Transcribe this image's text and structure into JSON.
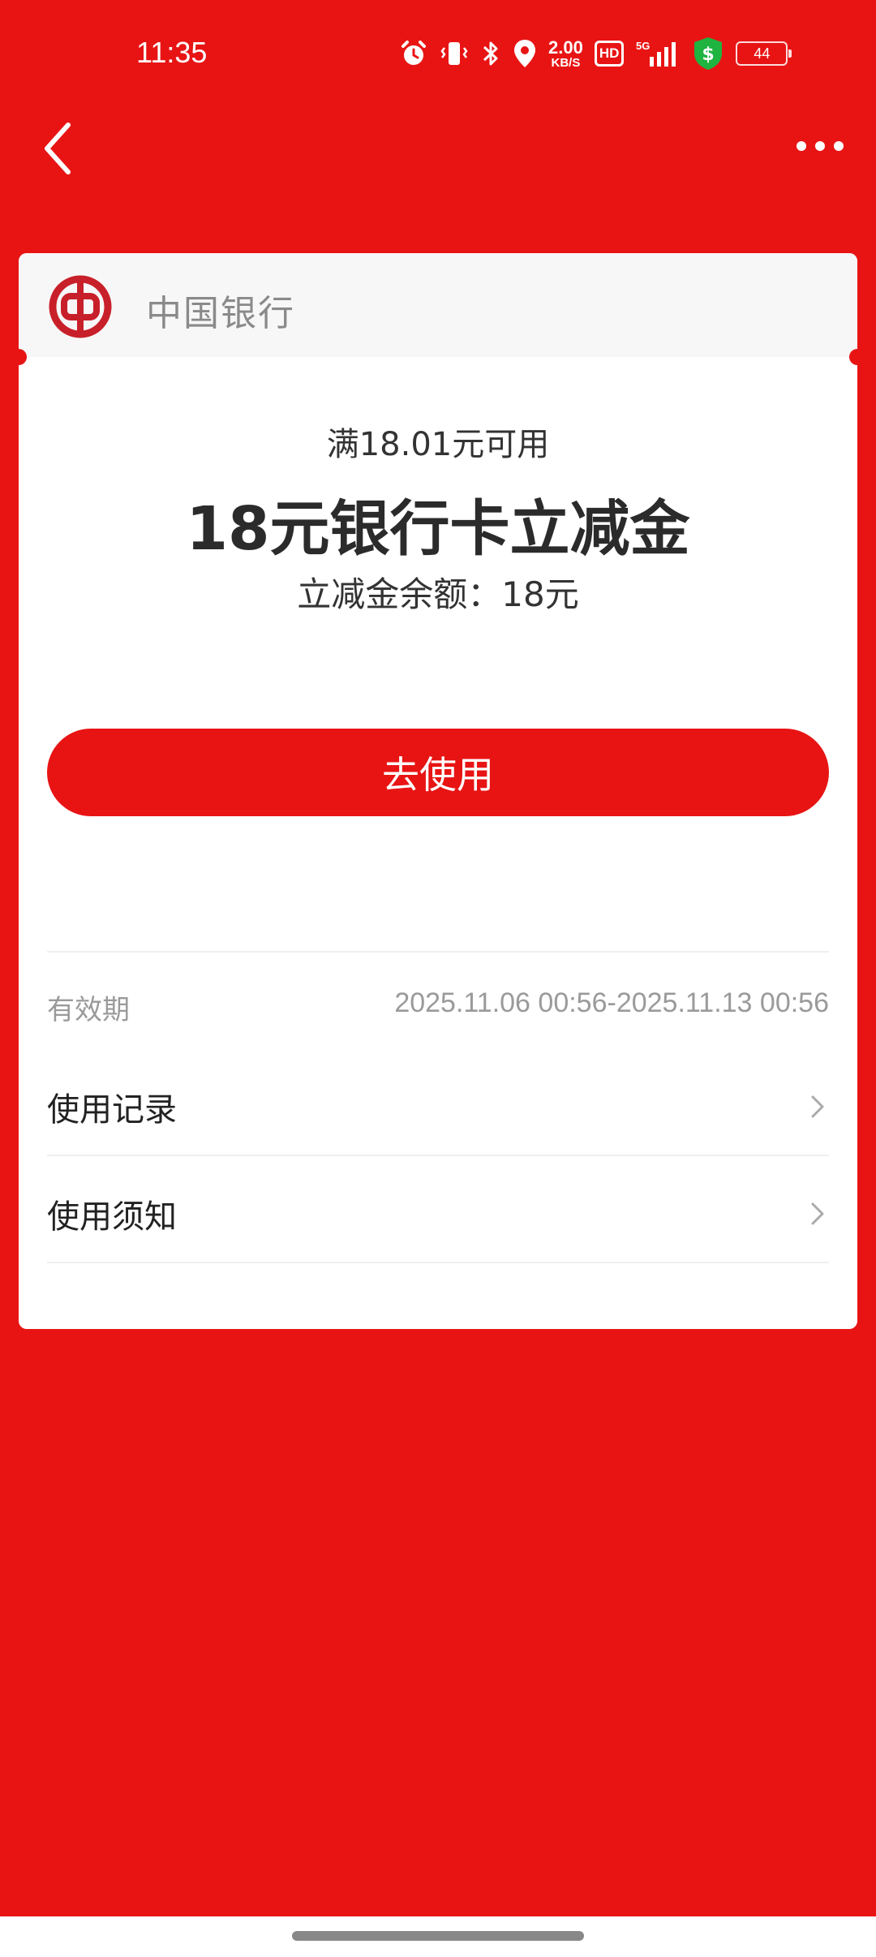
{
  "status_bar": {
    "time": "11:35",
    "net_speed_value": "2.00",
    "net_speed_unit": "KB/S",
    "hd_label": "HD",
    "network_label": "5G",
    "battery_level": "44",
    "icons": [
      "alarm-icon",
      "vibrate-icon",
      "bluetooth-icon",
      "location-icon",
      "signal-icon",
      "shield-dollar-icon",
      "battery-icon"
    ]
  },
  "nav": {
    "back_icon": "back-arrow-icon",
    "more_icon": "more-dots-icon"
  },
  "card": {
    "bank_name": "中国银行",
    "condition": "满18.01元可用",
    "title": "18元银行卡立减金",
    "balance": "立减金余额：18元",
    "use_button": "去使用",
    "validity_label": "有效期",
    "validity_value": "2025.11.06 00:56-2025.11.13 00:56",
    "rows": [
      {
        "label": "使用记录"
      },
      {
        "label": "使用须知"
      }
    ]
  },
  "colors": {
    "brand_red": "#e81414",
    "card_bg": "#ffffff",
    "header_bg": "#f7f7f7"
  }
}
